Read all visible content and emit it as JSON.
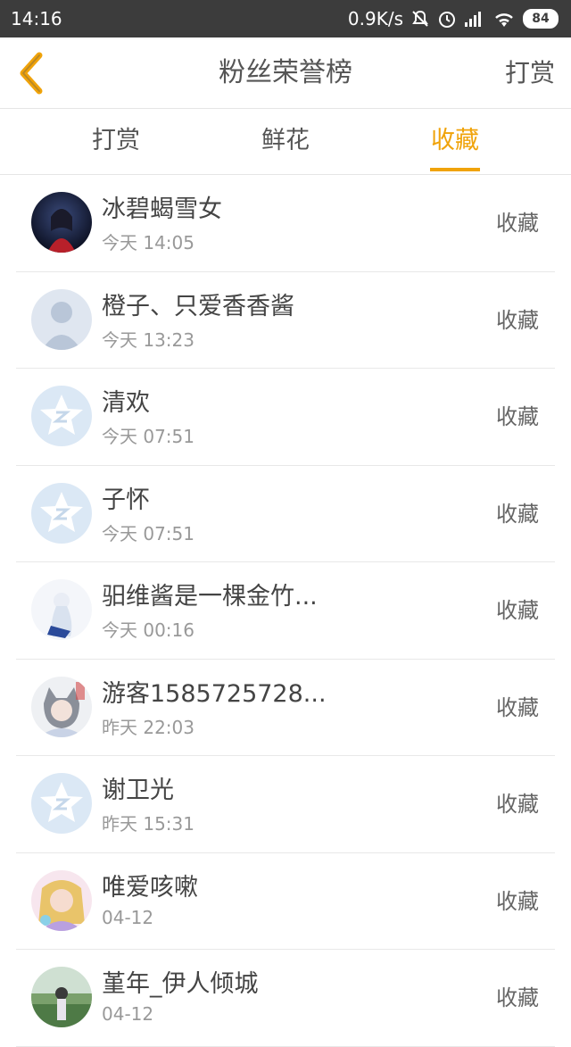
{
  "status_bar": {
    "time": "14:16",
    "net_speed": "0.9K/s",
    "battery": "84",
    "icons": [
      "mute-notification-icon",
      "alarm-icon",
      "signal-icon",
      "wifi-icon",
      "battery-icon"
    ]
  },
  "header": {
    "title": "粉丝荣誉榜",
    "action_label": "打赏",
    "back_icon": "chevron-left-icon",
    "accent_color": "#f0a30a"
  },
  "tabs": [
    {
      "label": "打赏",
      "active": false
    },
    {
      "label": "鲜花",
      "active": false
    },
    {
      "label": "收藏",
      "active": true
    }
  ],
  "fans": [
    {
      "name": "冰碧蝎雪女",
      "time": "今天 14:05",
      "action": "收藏",
      "avatar": "photo-dark"
    },
    {
      "name": "橙子、只爱香香酱",
      "time": "今天 13:23",
      "action": "收藏",
      "avatar": "default-person"
    },
    {
      "name": "清欢",
      "time": "今天 07:51",
      "action": "收藏",
      "avatar": "qzone-star"
    },
    {
      "name": "子怀",
      "time": "今天 07:51",
      "action": "收藏",
      "avatar": "qzone-star"
    },
    {
      "name": "驲维酱是一棵金竹...",
      "time": "今天 00:16",
      "action": "收藏",
      "avatar": "anime-light"
    },
    {
      "name": "游客1585725728...",
      "time": "昨天 22:03",
      "action": "收藏",
      "avatar": "anime-cat"
    },
    {
      "name": "谢卫光",
      "time": "昨天 15:31",
      "action": "收藏",
      "avatar": "qzone-star"
    },
    {
      "name": "唯爱咳嗽",
      "time": "04-12",
      "action": "收藏",
      "avatar": "anime-pink"
    },
    {
      "name": "堇年_伊人倾城",
      "time": "04-12",
      "action": "收藏",
      "avatar": "photo-field"
    }
  ]
}
